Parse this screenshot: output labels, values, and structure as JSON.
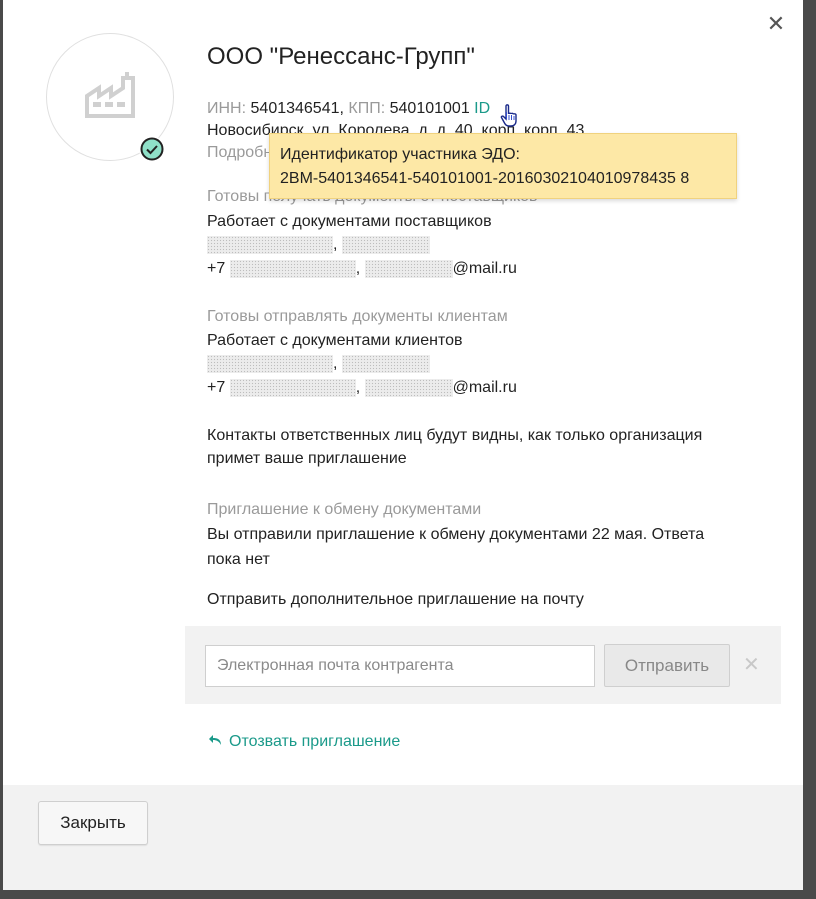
{
  "org": {
    "name": "ООО \"Ренессанс-Групп\"",
    "inn_label": "ИНН:",
    "inn_value": "5401346541,",
    "kpp_label": "КПП:",
    "kpp_value": "540101001",
    "id_link": "ID",
    "address": "Новосибирск, ул. Королева, д. д. 40, корп. корп. 43",
    "more_label": "Подробнее"
  },
  "tooltip": {
    "title": "Идентификатор участника ЭДО:",
    "value": "2BM-5401346541-540101001-20160302104010978435 8"
  },
  "receive": {
    "heading": "Готовы получать документы от поставщиков",
    "works_with": "Работает с документами поставщиков",
    "phone_prefix": "+7",
    "email_suffix": "@mail.ru"
  },
  "send": {
    "heading": "Готовы отправлять документы клиентам",
    "works_with": "Работает с документами клиентов",
    "phone_prefix": "+7",
    "email_suffix": "@mail.ru"
  },
  "contacts_note_line1": "Контакты ответственных лиц будут видны, как только организация",
  "contacts_note_line2": "примет ваше приглашение",
  "invitation": {
    "heading": "Приглашение к обмену документами",
    "text_line1": "Вы отправили приглашение к обмену документами 22 мая. Ответа",
    "text_line2": "пока нет",
    "extra_invite_label": "Отправить дополнительное приглашение на почту",
    "email_placeholder": "Электронная почта контрагента",
    "send_button": "Отправить",
    "revoke_link": "Отозвать приглашение"
  },
  "footer": {
    "close_button": "Закрыть"
  },
  "colors": {
    "accent": "#1b9a8a",
    "tooltip_bg": "#fde8a6",
    "panel_bg": "#f2f2f2"
  },
  "icons": {
    "close": "close-icon",
    "factory": "factory-icon",
    "verified": "check-circle-icon",
    "cursor": "hand-pointer-icon",
    "revoke": "undo-arrow-icon"
  }
}
